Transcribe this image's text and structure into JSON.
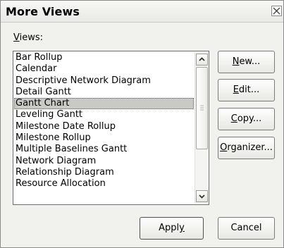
{
  "window": {
    "title": "More Views"
  },
  "views_label": {
    "mnemonic": "V",
    "rest": "iews:"
  },
  "views": {
    "items": [
      "Bar Rollup",
      "Calendar",
      "Descriptive Network Diagram",
      "Detail Gantt",
      "Gantt Chart",
      "Leveling Gantt",
      "Milestone Date Rollup",
      "Milestone Rollup",
      "Multiple Baselines Gantt",
      "Network Diagram",
      "Relationship Diagram",
      "Resource Allocation"
    ],
    "selected": "Gantt Chart",
    "scroll_position": 0
  },
  "buttons": {
    "new": {
      "mnemonic": "N",
      "rest": "ew..."
    },
    "edit": {
      "mnemonic": "E",
      "rest": "dit..."
    },
    "copy": {
      "mnemonic": "C",
      "rest": "opy..."
    },
    "organizer": {
      "mnemonic": "O",
      "rest": "rganizer..."
    },
    "apply": {
      "pre": "Appl",
      "mnemonic": "y"
    },
    "cancel": {
      "label": "Cancel"
    }
  },
  "icons": {
    "close": "close-icon",
    "scroll_up": "chevron-up-icon",
    "scroll_down": "chevron-down-icon",
    "thumb_grip": "grip-icon"
  }
}
